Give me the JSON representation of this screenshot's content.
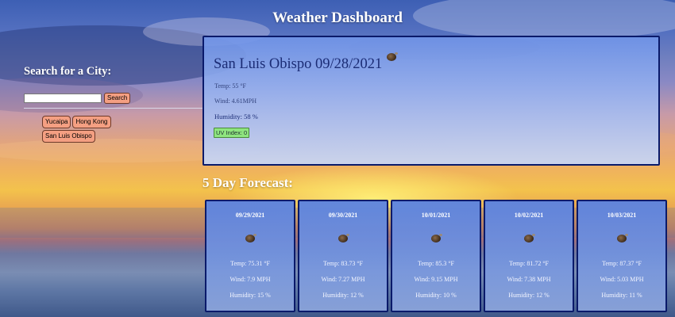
{
  "header": {
    "title": "Weather Dashboard"
  },
  "sidebar": {
    "heading": "Search for a City:",
    "search_value": "",
    "search_button": "Search",
    "history": [
      "Yucaipa",
      "Hong Kong",
      "San Luis Obispo"
    ]
  },
  "current": {
    "city_date": "San Luis Obispo 09/28/2021",
    "icon": "weather-icon",
    "temp": "Temp: 55 °F",
    "wind": "Wind: 4.61MPH",
    "humidity": "Humidity: 58 %",
    "uv": "UV Index: 0",
    "uv_color": "#8fe57f"
  },
  "forecast": {
    "title": "5 Day Forecast:",
    "days": [
      {
        "date": "09/29/2021",
        "temp": "Temp: 75.31 °F",
        "wind": "Wind: 7.9 MPH",
        "humidity": "Humidity: 15 %"
      },
      {
        "date": "09/30/2021",
        "temp": "Temp: 83.73 °F",
        "wind": "Wind: 7.27 MPH",
        "humidity": "Humidity: 12 %"
      },
      {
        "date": "10/01/2021",
        "temp": "Temp: 85.3 °F",
        "wind": "Wind: 9.15 MPH",
        "humidity": "Humidity: 10 %"
      },
      {
        "date": "10/02/2021",
        "temp": "Temp: 81.72 °F",
        "wind": "Wind: 7.38 MPH",
        "humidity": "Humidity: 12 %"
      },
      {
        "date": "10/03/2021",
        "temp": "Temp: 87.37 °F",
        "wind": "Wind: 5.03 MPH",
        "humidity": "Humidity: 11 %"
      }
    ]
  },
  "colors": {
    "accent_button": "#f49f82",
    "card_border": "#0a1a6a",
    "uv_low": "#8fe57f"
  }
}
